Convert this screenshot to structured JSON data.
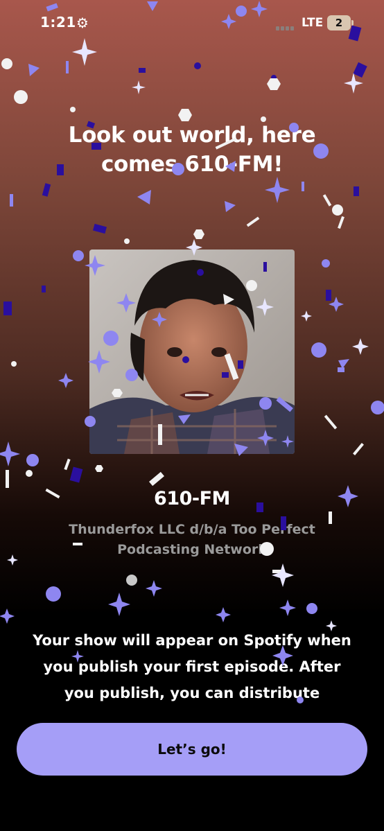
{
  "status_bar": {
    "time": "1:21",
    "network": "LTE",
    "battery": "2"
  },
  "celebration": {
    "headline": "Look out world, here comes 610-FM!"
  },
  "show": {
    "title": "610-FM",
    "publisher": "Thunderfox LLC d/b/a Too Perfect Podcasting Network"
  },
  "message": "Your show will appear on Spotify when you publish your first episode. After you publish, you can distribute",
  "cta": {
    "label": "Let’s go!"
  },
  "colors": {
    "accent": "#a59ef7",
    "confetti_dark": "#2a0f9e",
    "confetti_light": "#8e86f0",
    "confetti_white": "#f2f2f2"
  },
  "icons": [
    "gear-icon",
    "signal-icon",
    "battery-icon"
  ]
}
